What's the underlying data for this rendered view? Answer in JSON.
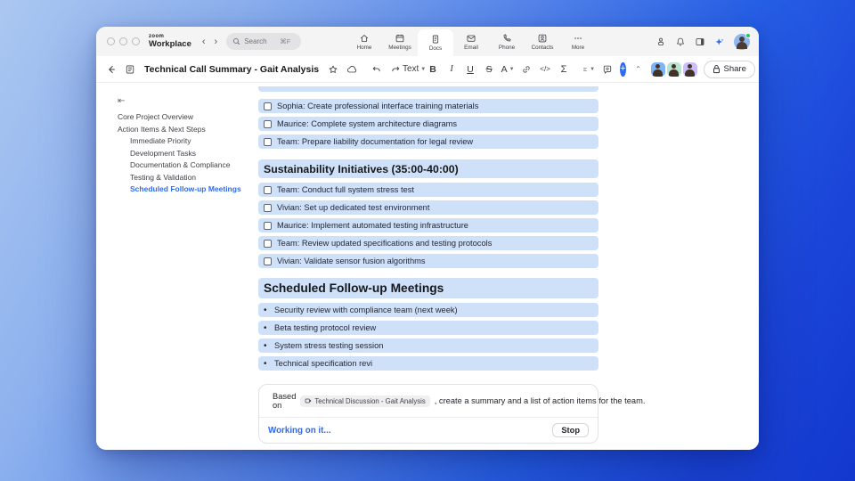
{
  "titlebar": {
    "logo_top": "zoom",
    "logo_bottom": "Workplace",
    "back": "‹",
    "forward": "›",
    "search": {
      "placeholder": "Search",
      "shortcut": "⌘F"
    },
    "tabs": [
      {
        "label": "Home"
      },
      {
        "label": "Meetings"
      },
      {
        "label": "Docs"
      },
      {
        "label": "Email"
      },
      {
        "label": "Phone"
      },
      {
        "label": "Contacts"
      },
      {
        "label": "More"
      }
    ],
    "active_tab": "Docs"
  },
  "toolbar": {
    "doc_title": "Technical Call Summary - Gait Analysis",
    "text_style_label": "Text",
    "bold_label": "B",
    "italic_label": "I",
    "underline_label": "U",
    "strike_label": "S",
    "color_label": "A",
    "code_label": "</>",
    "sigma_label": "Σ",
    "share_label": "Share"
  },
  "sidebar": {
    "items": [
      {
        "label": "Core Project Overview",
        "level": 0,
        "active": false
      },
      {
        "label": "Action Items & Next Steps",
        "level": 0,
        "active": false
      },
      {
        "label": "Immediate Priority",
        "level": 1,
        "active": false
      },
      {
        "label": "Development Tasks",
        "level": 1,
        "active": false
      },
      {
        "label": "Documentation & Compliance",
        "level": 1,
        "active": false
      },
      {
        "label": "Testing & Validation",
        "level": 1,
        "active": false
      },
      {
        "label": "Scheduled Follow-up Meetings",
        "level": 1,
        "active": true
      }
    ]
  },
  "doc": {
    "checklist_a": [
      "Sophia: Create professional interface training materials",
      "Maurice: Complete system architecture diagrams",
      "Team: Prepare liability documentation for legal review"
    ],
    "heading_a": "Sustainability Initiatives (35:00-40:00)",
    "checklist_b": [
      "Team: Conduct full system stress test",
      "Vivian: Set up dedicated test environment",
      "Maurice: Implement automated testing infrastructure",
      "Team: Review updated specifications and testing protocols",
      "Vivian: Validate sensor fusion algorithms"
    ],
    "heading_b": "Scheduled Follow-up Meetings",
    "bullets": [
      "Security review with compliance team (next week)",
      "Beta testing protocol review",
      "System stress testing session",
      "Technical specification revi"
    ],
    "bullet_glyph": "•"
  },
  "ai_panel": {
    "prefix": "Based on",
    "source_doc": "Technical Discussion - Gait Analysis",
    "suffix": ", create a summary and a list of action items for the team.",
    "status": "Working on it...",
    "stop_label": "Stop"
  },
  "colors": {
    "accent_blue": "#2e6bf0",
    "highlight_blue": "#cfe1f8",
    "desktop_blue": "#1b45d9",
    "topbar_gray": "#f4f4f5"
  }
}
